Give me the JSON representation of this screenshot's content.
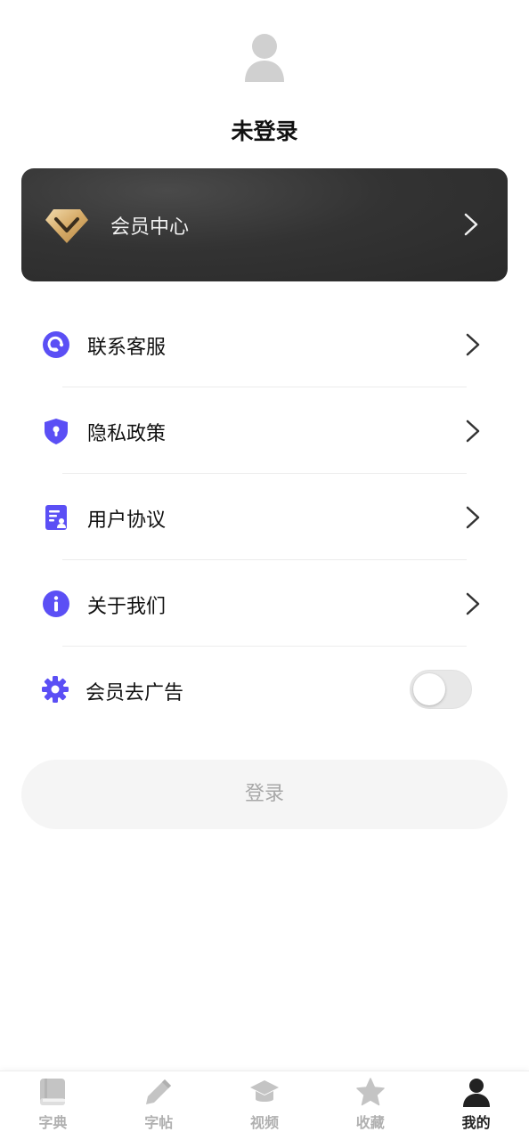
{
  "profile": {
    "username": "未登录",
    "avatar_icon": "user-silhouette-icon"
  },
  "vip_card": {
    "label": "会员中心",
    "icon": "diamond-icon",
    "accent": "#d9b57a"
  },
  "menu": {
    "items": [
      {
        "label": "联系客服",
        "icon": "customer-service-icon"
      },
      {
        "label": "隐私政策",
        "icon": "shield-lock-icon"
      },
      {
        "label": "用户协议",
        "icon": "document-user-icon"
      },
      {
        "label": "关于我们",
        "icon": "info-icon"
      }
    ],
    "toggle_item": {
      "label": "会员去广告",
      "icon": "gear-icon",
      "enabled": false
    }
  },
  "login_button": {
    "label": "登录"
  },
  "tabbar": {
    "tabs": [
      {
        "label": "字典",
        "icon": "book-icon",
        "active": false
      },
      {
        "label": "字帖",
        "icon": "pencil-icon",
        "active": false
      },
      {
        "label": "视频",
        "icon": "graduation-cap-icon",
        "active": false
      },
      {
        "label": "收藏",
        "icon": "star-icon",
        "active": false
      },
      {
        "label": "我的",
        "icon": "person-icon",
        "active": true
      }
    ]
  },
  "colors": {
    "primary": "#5b4ff5",
    "inactive": "#c4c4c4",
    "active": "#222222"
  }
}
